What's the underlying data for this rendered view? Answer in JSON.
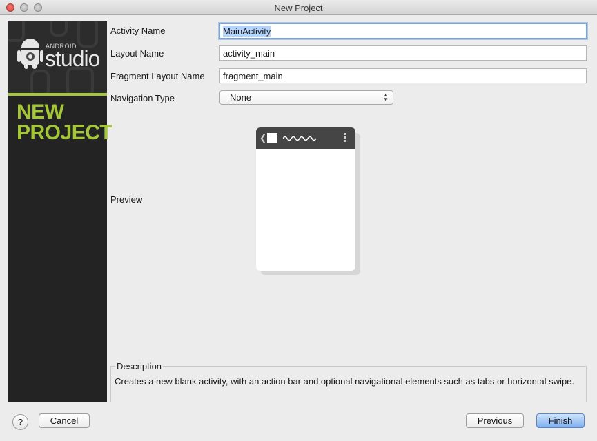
{
  "window": {
    "title": "New Project"
  },
  "banner": {
    "logo_small": "ANDROID",
    "logo_large": "studio",
    "title_line1": "NEW",
    "title_line2": "PROJECT",
    "accent_color": "#a4c639"
  },
  "form": {
    "activity_name": {
      "label": "Activity Name",
      "value": "MainActivity"
    },
    "layout_name": {
      "label": "Layout Name",
      "value": "activity_main"
    },
    "fragment_layout_name": {
      "label": "Fragment Layout Name",
      "value": "fragment_main"
    },
    "navigation_type": {
      "label": "Navigation Type",
      "selected": "None"
    },
    "preview": {
      "label": "Preview"
    }
  },
  "description": {
    "legend": "Description",
    "text": "Creates a new blank activity, with an action bar and optional navigational elements such as tabs or horizontal swipe."
  },
  "buttons": {
    "help": "?",
    "cancel": "Cancel",
    "previous": "Previous",
    "finish": "Finish"
  },
  "icons": {
    "close": "close-icon",
    "minimize": "minimize-icon",
    "zoom": "zoom-icon",
    "android": "android-robot-icon"
  }
}
